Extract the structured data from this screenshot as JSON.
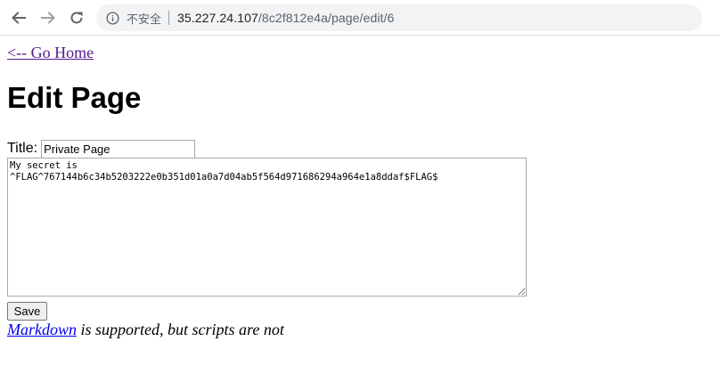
{
  "browser": {
    "security_label": "不安全",
    "url_host": "35.227.24.107",
    "url_path": "/8c2f812e4a/page/edit/6"
  },
  "page": {
    "home_link": "<-- Go Home",
    "heading": "Edit Page",
    "title_label": "Title:",
    "title_value": "Private Page",
    "body_value": "My secret is\n^FLAG^767144b6c34b5203222e0b351d01a0a7d04ab5f564d971686294a964e1a8ddaf$FLAG$",
    "save_label": "Save",
    "markdown_link": "Markdown",
    "hint_text": " is supported, but scripts are not"
  },
  "colors": {
    "visited_link": "#551a8b",
    "link": "#0000ee",
    "omnibox_bg": "#f1f3f4"
  },
  "icons": [
    "back-arrow-icon",
    "forward-arrow-icon",
    "reload-icon",
    "info-icon"
  ]
}
